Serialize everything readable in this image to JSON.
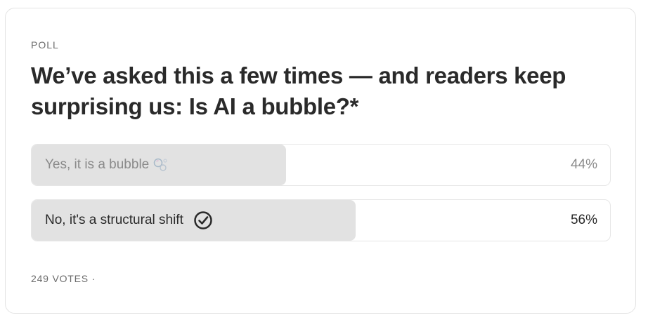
{
  "poll": {
    "label": "POLL",
    "question": "We’ve asked this a few times — and readers keep surprising us: Is AI a bubble?*",
    "options": [
      {
        "label": "Yes, it is a bubble",
        "percent_text": "44%",
        "share": 0.44,
        "selected": false,
        "icon": "bubbles-icon"
      },
      {
        "label": "No, it's a structural shift",
        "percent_text": "56%",
        "share": 0.56,
        "selected": true,
        "icon": "check-circle-icon"
      }
    ],
    "votes_text": "249 VOTES ·"
  },
  "colors": {
    "fill": "#e2e2e2",
    "border": "#e6e6e6",
    "text": "#2a2a2a",
    "muted_text": "#8a8a8a"
  }
}
